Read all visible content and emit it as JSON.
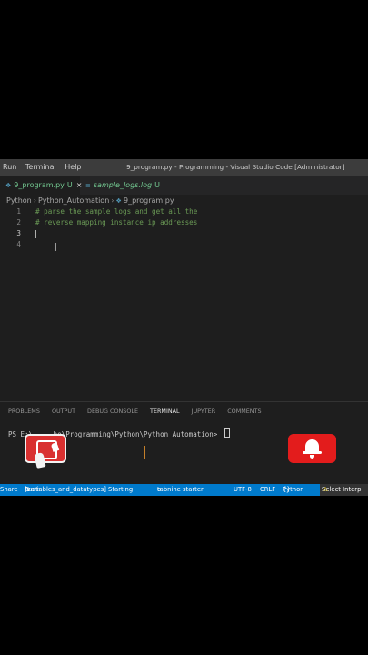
{
  "menu": {
    "items": [
      "Run",
      "Terminal",
      "Help"
    ]
  },
  "window_title": "9_program.py - Programming - Visual Studio Code [Administrator]",
  "tabs": [
    {
      "label": "9_program.py",
      "status": "U",
      "active": true
    },
    {
      "label": "sample_logs.log",
      "status": "U",
      "active": false
    }
  ],
  "breadcrumb": {
    "parts": [
      "Python",
      "Python_Automation",
      "9_program.py"
    ]
  },
  "editor": {
    "lines": [
      {
        "num": "1",
        "text": "# parse the sample logs and get all the"
      },
      {
        "num": "2",
        "text": "# reverse mapping instance ip addresses"
      },
      {
        "num": "3",
        "text": ""
      },
      {
        "num": "4",
        "text": ""
      }
    ]
  },
  "panel": {
    "tabs": [
      "PROBLEMS",
      "OUTPUT",
      "DEBUG CONSOLE",
      "TERMINAL",
      "JUPYTER",
      "COMMENTS"
    ],
    "active_tab": "TERMINAL",
    "prompt": "PS E:\\     he\\Programming\\Python\\Python_Automation> "
  },
  "statusbar": {
    "share": "Share",
    "rust": "Rust: ",
    "rust_status": "[variables_and_datatypes] Starting",
    "tabnine": "tabnine starter",
    "encoding": "UTF-8",
    "eol": "CRLF",
    "language": "Python",
    "interpreter": "Select Interp"
  },
  "colors": {
    "status_bar": "#007acc",
    "comment": "#6a9955",
    "like_sticker": "#d93030",
    "bell_sticker": "#e31c1c"
  },
  "icons": {
    "tab_file": "python-file-icon",
    "like": "thumbs-up-icon",
    "bell": "bell-icon"
  }
}
